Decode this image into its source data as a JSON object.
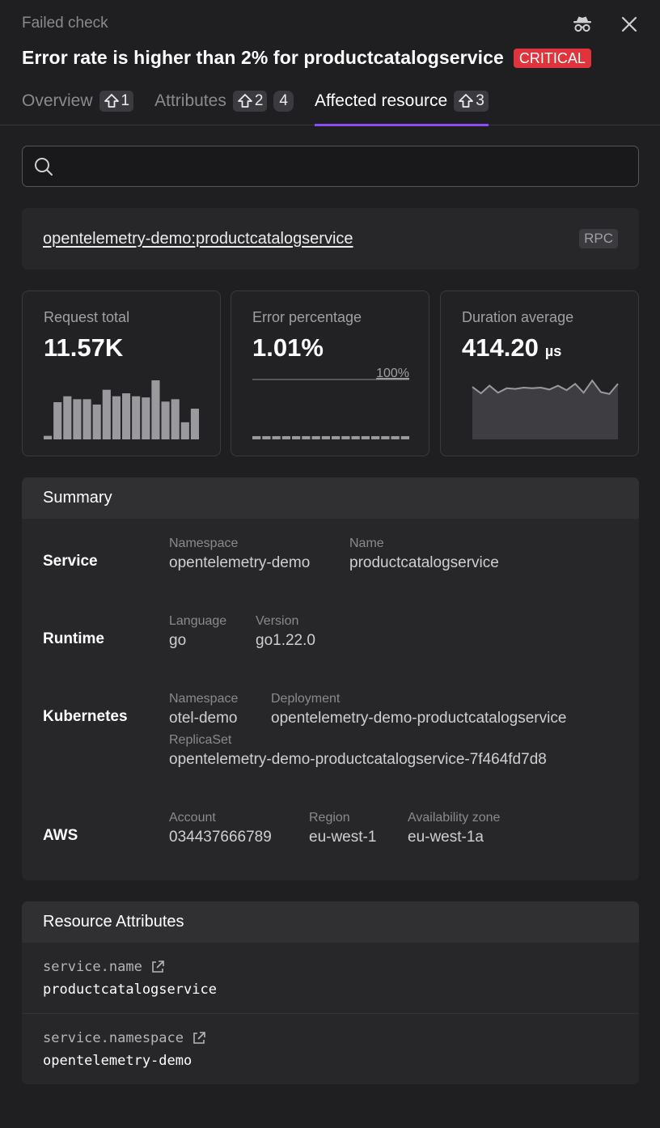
{
  "header": {
    "eyebrow": "Failed check",
    "title": "Error rate is higher than 2% for productcatalogservice",
    "severity": "CRITICAL",
    "severity_color": "#e0333b",
    "icons": [
      "spy-icon",
      "close-icon"
    ]
  },
  "tabs": [
    {
      "label": "Overview",
      "count": "1"
    },
    {
      "label": "Attributes",
      "count": "2",
      "extra": "4"
    },
    {
      "label": "Affected resource",
      "count": "3",
      "active": true
    }
  ],
  "accent_color": "#8b4cf2",
  "search": {
    "placeholder": "",
    "value": ""
  },
  "resource": {
    "name": "opentelemetry-demo:productcatalogservice",
    "tag": "RPC"
  },
  "metrics": {
    "request_total": {
      "label": "Request total",
      "value": "11.57K",
      "bars": [
        0.06,
        0.63,
        0.73,
        0.68,
        0.68,
        0.59,
        0.84,
        0.73,
        0.78,
        0.73,
        0.71,
        1.0,
        0.64,
        0.68,
        0.29,
        0.52
      ]
    },
    "error_percentage": {
      "label": "Error percentage",
      "value": "1.01%",
      "max_label": "100%",
      "bars": [
        0.0101,
        0.0101,
        0.0101,
        0.0101,
        0.0101,
        0.0101,
        0.0101,
        0.0101,
        0.0101,
        0.0101,
        0.0101,
        0.0101,
        0.0101,
        0.0101,
        0.0101,
        0.0101
      ]
    },
    "duration_average": {
      "label": "Duration average",
      "value": "414.20",
      "unit": "µs",
      "series": [
        0.82,
        0.72,
        0.84,
        0.73,
        0.8,
        0.79,
        0.81,
        0.8,
        0.81,
        0.78,
        0.84,
        0.77,
        0.87,
        0.73,
        0.92,
        0.74,
        0.71,
        0.87
      ]
    }
  },
  "summary": {
    "title": "Summary",
    "rows": [
      {
        "label": "Service",
        "fields": [
          {
            "key": "Namespace",
            "value": "opentelemetry-demo"
          },
          {
            "key": "Name",
            "value": "productcatalogservice"
          }
        ]
      },
      {
        "label": "Runtime",
        "fields": [
          {
            "key": "Language",
            "value": "go"
          },
          {
            "key": "Version",
            "value": "go1.22.0"
          }
        ]
      },
      {
        "label": "Kubernetes",
        "fields": [
          {
            "key": "Namespace",
            "value": "otel-demo"
          },
          {
            "key": "Deployment",
            "value": "opentelemetry-demo-productcatalogservice"
          },
          {
            "key": "ReplicaSet",
            "value": "opentelemetry-demo-productcatalogservice-7f464fd7d8"
          }
        ]
      },
      {
        "label": "AWS",
        "fields": [
          {
            "key": "Account",
            "value": "034437666789"
          },
          {
            "key": "Region",
            "value": "eu-west-1"
          },
          {
            "key": "Availability zone",
            "value": "eu-west-1a"
          }
        ]
      }
    ]
  },
  "resource_attributes": {
    "title": "Resource Attributes",
    "items": [
      {
        "key": "service.name",
        "value": "productcatalogservice"
      },
      {
        "key": "service.namespace",
        "value": "opentelemetry-demo"
      }
    ]
  }
}
